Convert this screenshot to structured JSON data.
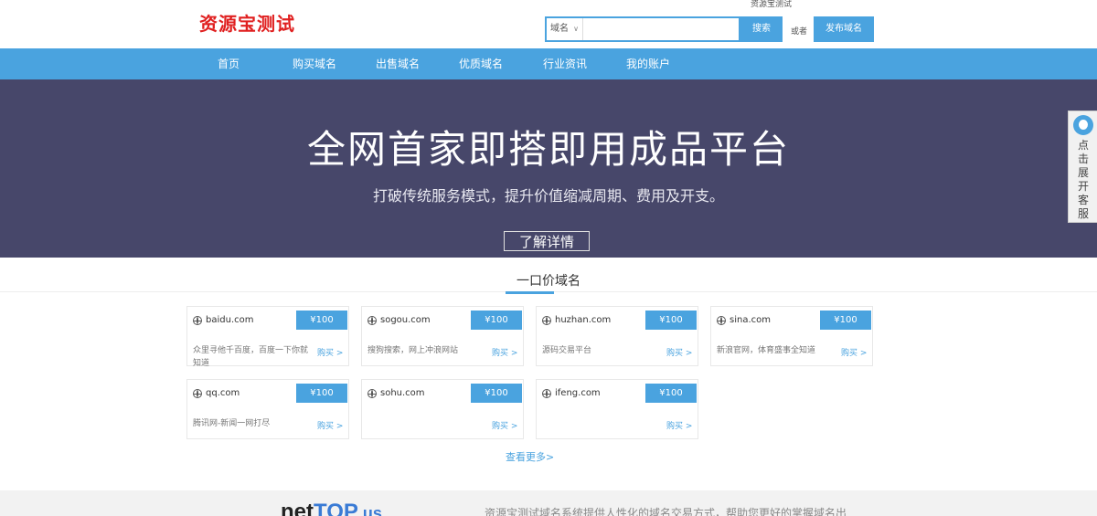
{
  "header": {
    "logo": "资源宝测试",
    "top_link": "资源宝测试",
    "search_type": "域名",
    "search_placeholder": "",
    "search_button": "搜索",
    "or_text": "或者",
    "publish_button": "发布域名"
  },
  "nav": {
    "items": [
      {
        "label": "首页"
      },
      {
        "label": "购买域名"
      },
      {
        "label": "出售域名"
      },
      {
        "label": "优质域名"
      },
      {
        "label": "行业资讯"
      },
      {
        "label": "我的账户"
      }
    ]
  },
  "hero": {
    "title": "全网首家即搭即用成品平台",
    "subtitle": "打破传统服务模式，提升价值缩减周期、费用及开支。",
    "button": "了解详情"
  },
  "domains": {
    "section_title": "一口价域名",
    "buy_label": "购买 >",
    "items": [
      {
        "domain": "baidu.com",
        "price": "¥100",
        "desc": "众里寻他千百度，百度一下你就知道"
      },
      {
        "domain": "sogou.com",
        "price": "¥100",
        "desc": "搜狗搜索，网上冲浪网站"
      },
      {
        "domain": "huzhan.com",
        "price": "¥100",
        "desc": "源码交易平台"
      },
      {
        "domain": "sina.com",
        "price": "¥100",
        "desc": "新浪官网，体育盛事全知道"
      },
      {
        "domain": "qq.com",
        "price": "¥100",
        "desc": "腾讯网-新闻一网打尽"
      },
      {
        "domain": "sohu.com",
        "price": "¥100",
        "desc": ""
      },
      {
        "domain": "ifeng.com",
        "price": "¥100",
        "desc": ""
      }
    ],
    "more": "查看更多>"
  },
  "footer": {
    "logo_a": "net",
    "logo_b": "TOP",
    "logo_c": ".us",
    "text": "资源宝测试域名系统提供人性化的域名交易方式，帮助您更好的掌握域名出"
  },
  "service_widget": {
    "label": "点击展开客服"
  }
}
